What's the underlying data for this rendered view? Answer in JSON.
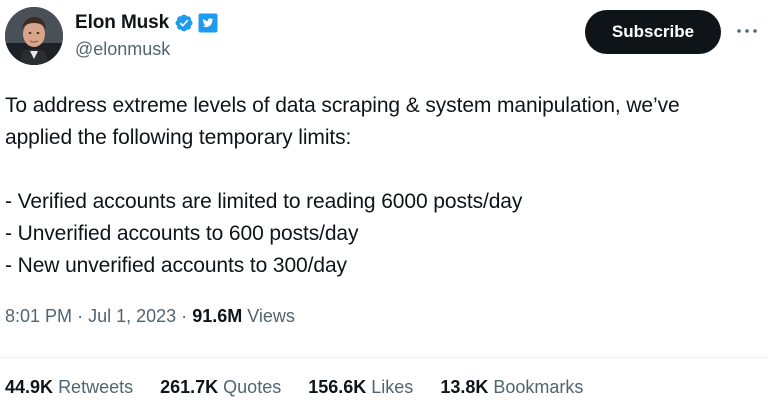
{
  "author": {
    "display_name": "Elon Musk",
    "handle": "@elonmusk",
    "verified_badge_color": "#1d9bf0",
    "affiliation_badge_color": "#1d9bf0"
  },
  "actions": {
    "subscribe_label": "Subscribe",
    "more_icon": "ellipsis-icon"
  },
  "tweet": {
    "lines": [
      "To address extreme levels of data scraping & system manipulation, we’ve",
      "applied the following temporary limits:",
      "",
      "- Verified accounts are limited to reading 6000 posts/day",
      "- Unverified accounts to 600 posts/day",
      "- New unverified accounts to 300/day"
    ]
  },
  "meta": {
    "time": "8:01 PM",
    "separator": "·",
    "date": "Jul 1, 2023",
    "views_count": "91.6M",
    "views_label": "Views"
  },
  "stats": {
    "retweets_count": "44.9K",
    "retweets_label": "Retweets",
    "quotes_count": "261.7K",
    "quotes_label": "Quotes",
    "likes_count": "156.6K",
    "likes_label": "Likes",
    "bookmarks_count": "13.8K",
    "bookmarks_label": "Bookmarks"
  },
  "colors": {
    "text_primary": "#0f1419",
    "text_secondary": "#536471",
    "button_bg": "#0f1419",
    "divider": "#eff3f4"
  }
}
